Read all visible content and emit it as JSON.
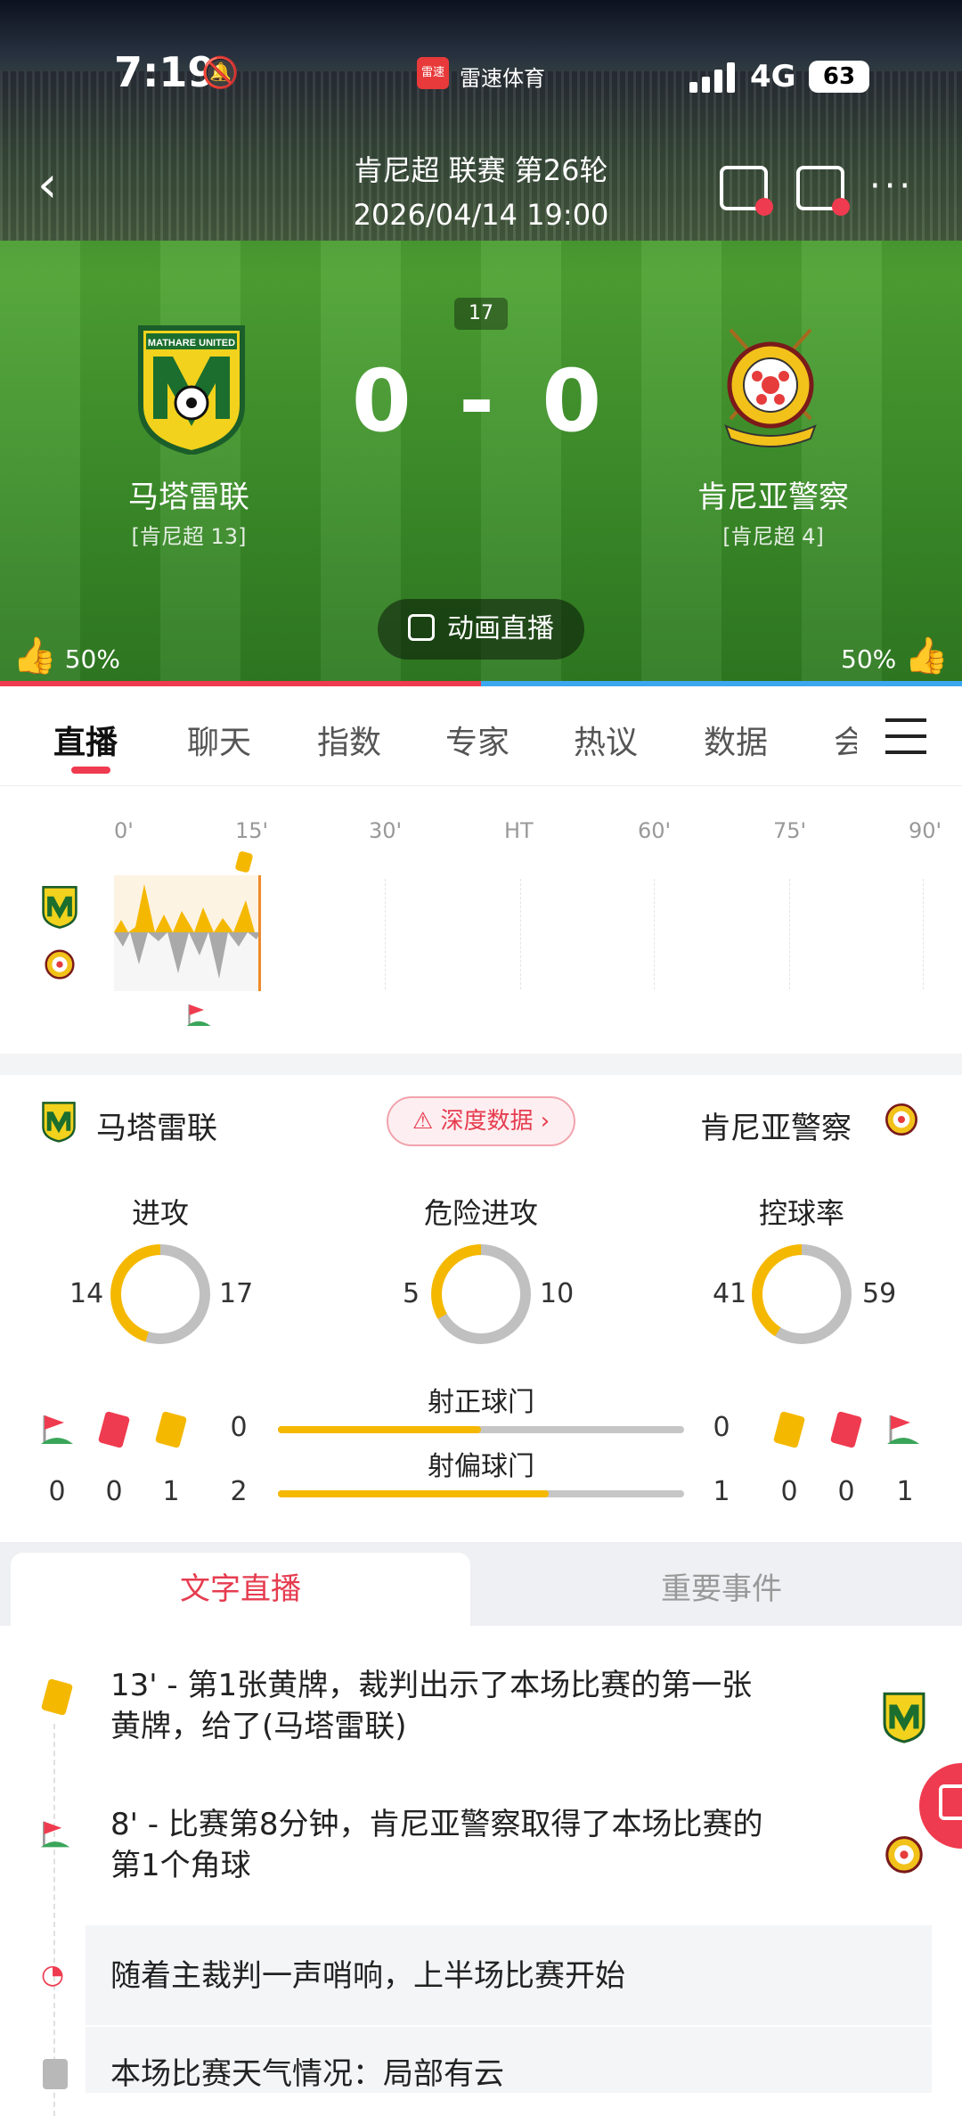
{
  "status_bar": {
    "time": "7:19",
    "app_badge": "雷速",
    "app_name": "雷速体育",
    "network": "4G",
    "battery": "63"
  },
  "match": {
    "league": "肯尼超 联赛 第26轮",
    "datetime": "2026/04/14 19:00",
    "minute": "17",
    "home": {
      "name": "马塔雷联",
      "rank": "[肯尼超 13]",
      "score": "0"
    },
    "away": {
      "name": "肯尼亚警察",
      "rank": "[肯尼超 4]",
      "score": "0"
    },
    "score_separator": "-",
    "animation_label": "动画直播",
    "vote_home": "50%",
    "vote_away": "50%",
    "vote_home_fraction": 0.5
  },
  "tabs": [
    "直播",
    "聊天",
    "指数",
    "专家",
    "热议",
    "数据",
    "会"
  ],
  "timeline": {
    "labels": [
      "0'",
      "15'",
      "30'",
      "HT",
      "60'",
      "75'",
      "90'"
    ]
  },
  "stats": {
    "deep_data_label": "深度数据",
    "home_team": "马塔雷联",
    "away_team": "肯尼亚警察",
    "donuts": [
      {
        "title": "进攻",
        "home": "14",
        "away": "17"
      },
      {
        "title": "危险进攻",
        "home": "5",
        "away": "10"
      },
      {
        "title": "控球率",
        "home": "41",
        "away": "59"
      }
    ],
    "shots_on_target": {
      "label": "射正球门",
      "home": "0",
      "away": "0",
      "home_fraction": 0.5
    },
    "shots_off_target": {
      "label": "射偏球门",
      "home": "2",
      "away": "1",
      "home_fraction": 0.667
    },
    "home_events": {
      "corners": "0",
      "red": "0",
      "yellow": "1"
    },
    "away_events": {
      "yellow": "0",
      "red": "0",
      "corners": "1"
    }
  },
  "live_tabs": {
    "text_live": "文字直播",
    "key_events": "重要事件"
  },
  "feed": [
    {
      "line1": "13' - 第1张黄牌，裁判出示了本场比赛的第一张",
      "line2": "黄牌，给了(马塔雷联)",
      "icon": "yellow-card-icon"
    },
    {
      "line1": "8' - 比赛第8分钟，肯尼亚警察取得了本场比赛的",
      "line2": "第1个角球",
      "icon": "corner-flag-icon"
    },
    {
      "line1": "随着主裁判一声哨响，上半场比赛开始",
      "icon": "whistle-icon"
    },
    {
      "line1": "本场比赛天气情况：局部有云",
      "icon": "note-icon"
    }
  ],
  "colors": {
    "accent": "#ef3b4f",
    "away_blue": "#3ba7f0",
    "yellow": "#f5b800",
    "grass": "#4ea233"
  }
}
